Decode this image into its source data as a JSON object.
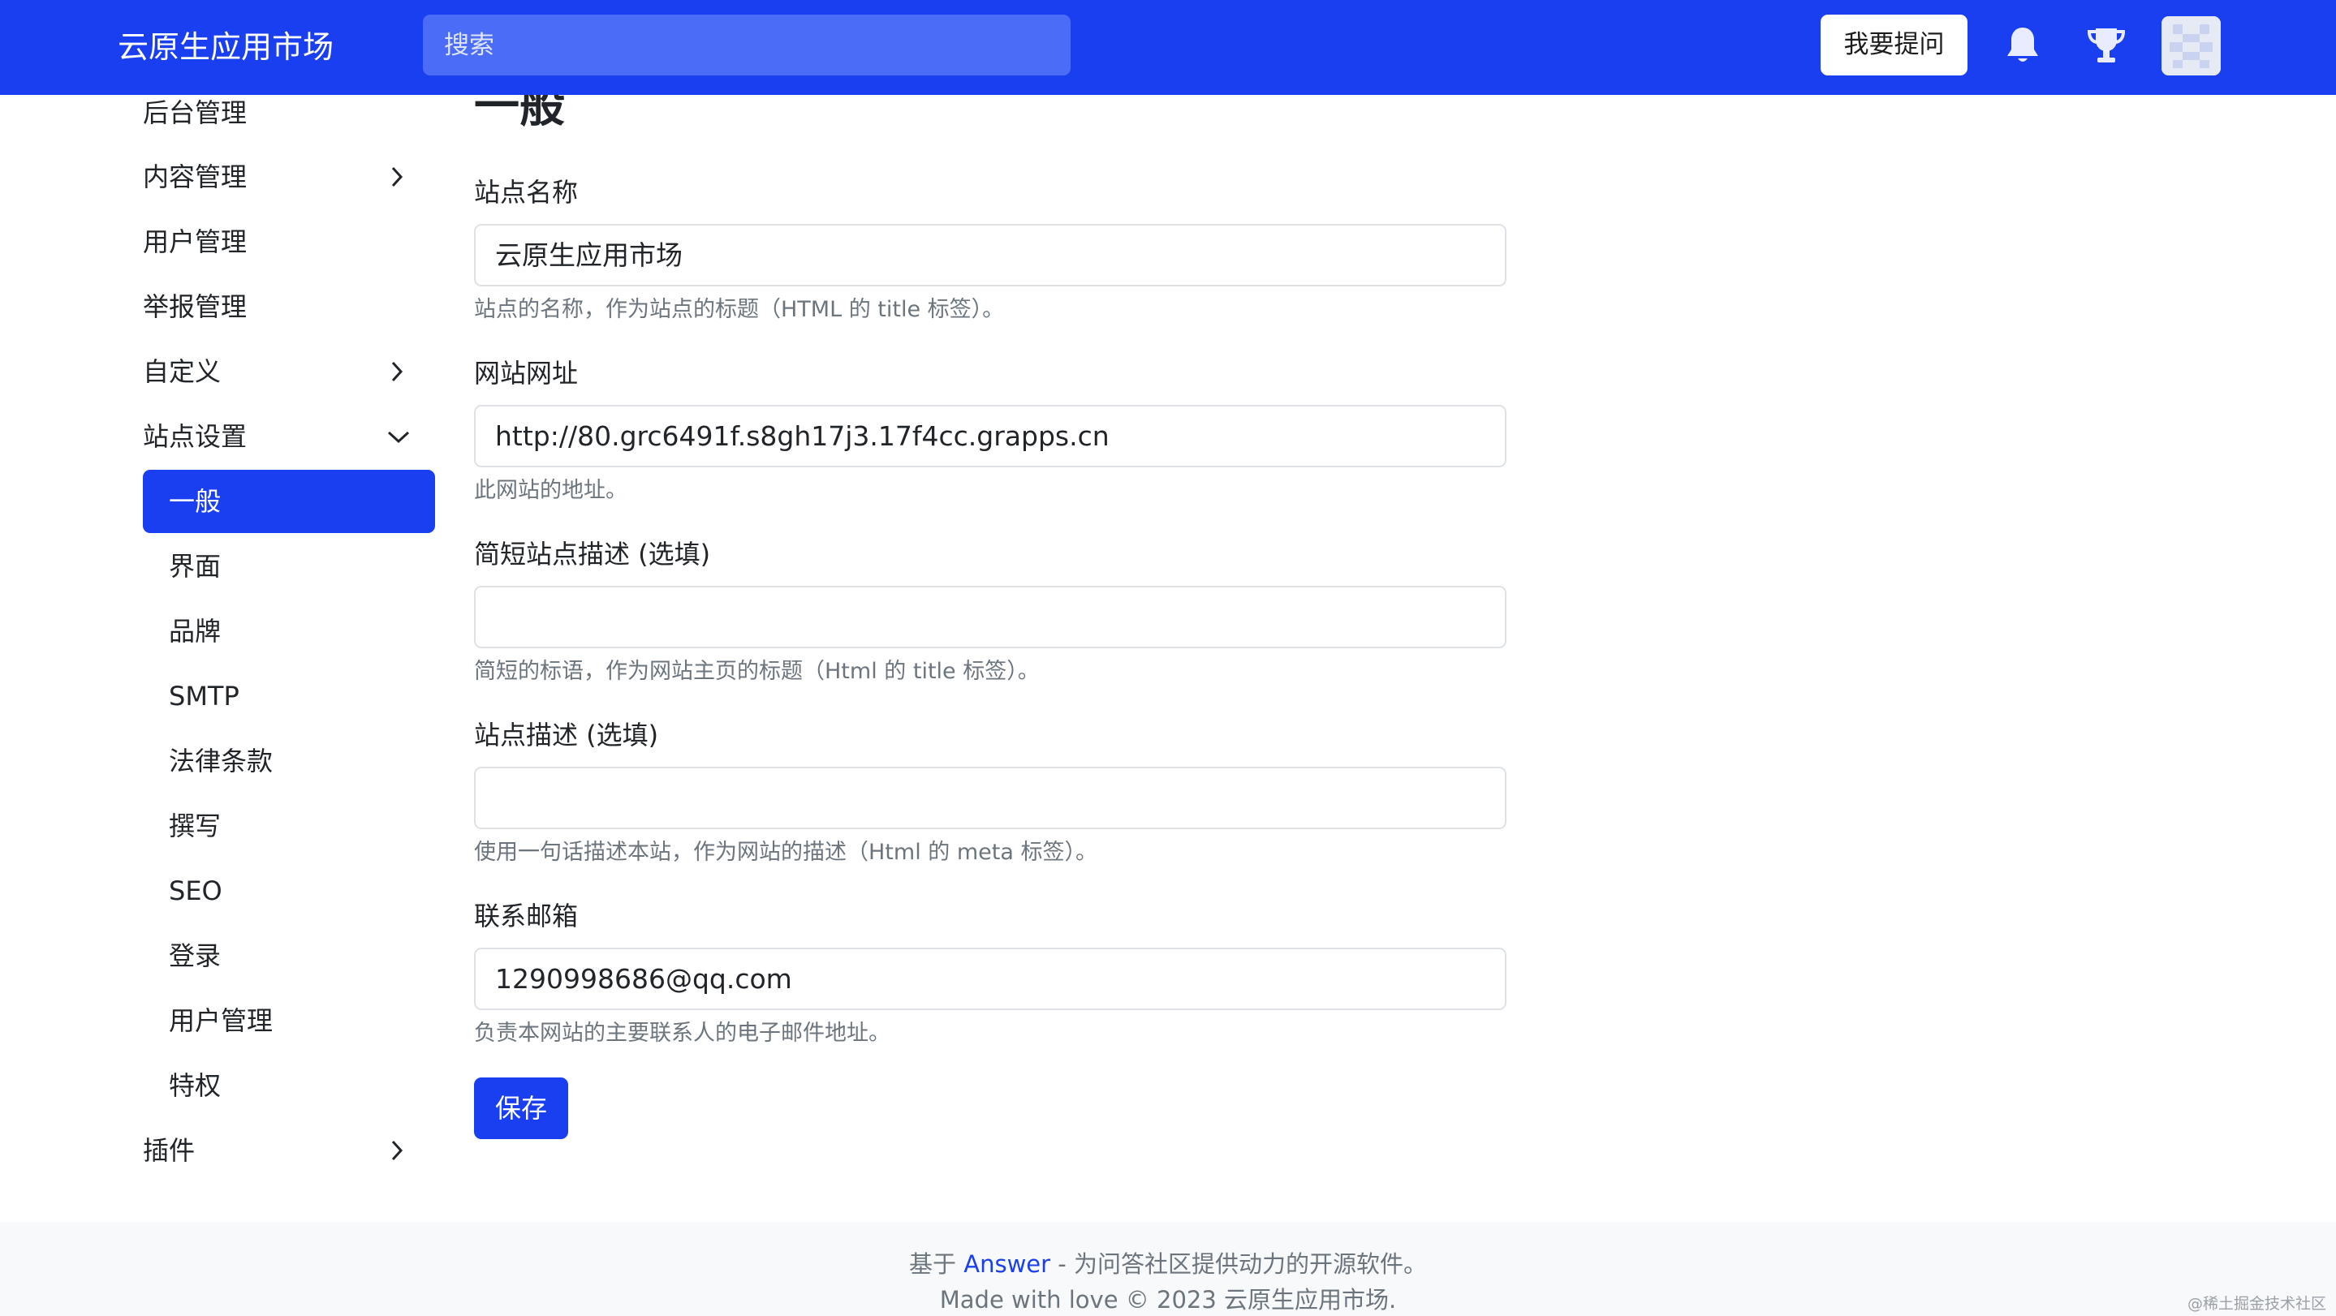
{
  "header": {
    "brand": "云原生应用市场",
    "search_placeholder": "搜索",
    "ask_button": "我要提问",
    "icons": [
      "bell-icon",
      "trophy-icon",
      "avatar"
    ],
    "color": "#1a3ff0"
  },
  "sidebar": {
    "items": [
      {
        "label": "后台管理"
      },
      {
        "label": "内容管理",
        "chevron": "right"
      },
      {
        "label": "用户管理"
      },
      {
        "label": "举报管理"
      },
      {
        "label": "自定义",
        "chevron": "right"
      },
      {
        "label": "站点设置",
        "chevron": "down"
      }
    ],
    "sub_items": [
      {
        "label": "一般",
        "active": true
      },
      {
        "label": "界面"
      },
      {
        "label": "品牌"
      },
      {
        "label": "SMTP"
      },
      {
        "label": "法律条款"
      },
      {
        "label": "撰写"
      },
      {
        "label": "SEO"
      },
      {
        "label": "登录"
      },
      {
        "label": "用户管理"
      },
      {
        "label": "特权"
      }
    ],
    "plugins": {
      "label": "插件",
      "chevron": "right"
    }
  },
  "main": {
    "title": "一般",
    "fields": [
      {
        "label": "站点名称",
        "value": "云原生应用市场",
        "help": "站点的名称，作为站点的标题（HTML 的 title 标签）。"
      },
      {
        "label": "网站网址",
        "value": "http://80.grc6491f.s8gh17j3.17f4cc.grapps.cn",
        "help": "此网站的地址。"
      },
      {
        "label": "简短站点描述 (选填)",
        "value": "",
        "help": "简短的标语，作为网站主页的标题（Html 的 title 标签）。"
      },
      {
        "label": "站点描述 (选填)",
        "value": "",
        "help": "使用一句话描述本站，作为网站的描述（Html 的 meta 标签）。"
      },
      {
        "label": "联系邮箱",
        "value": "1290998686@qq.com",
        "help": "负责本网站的主要联系人的电子邮件地址。"
      }
    ],
    "save_button": "保存"
  },
  "footer": {
    "prefix": "基于",
    "link": "Answer",
    "suffix": " - 为问答社区提供动力的开源软件。",
    "line2": "Made with love © 2023 云原生应用市场."
  },
  "watermark": "@稀土掘金技术社区"
}
